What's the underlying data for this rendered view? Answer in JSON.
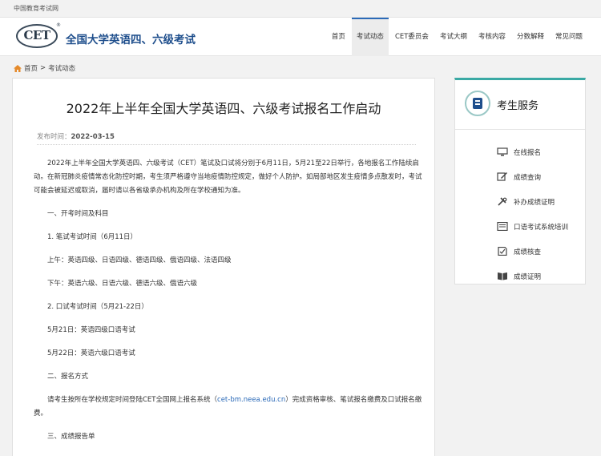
{
  "topbar": {
    "site_name": "中国教育考试网"
  },
  "header": {
    "logo_text": "CET",
    "logo_mark": "®",
    "title": "全国大学英语四、六级考试"
  },
  "nav": {
    "items": [
      {
        "label": "首页"
      },
      {
        "label": "考试动态"
      },
      {
        "label": "CET委员会"
      },
      {
        "label": "考试大纲"
      },
      {
        "label": "考核内容"
      },
      {
        "label": "分数解释"
      },
      {
        "label": "常见问题"
      }
    ]
  },
  "breadcrumb": {
    "home": "首页",
    "separator": ">",
    "current": "考试动态"
  },
  "article": {
    "title": "2022年上半年全国大学英语四、六级考试报名工作启动",
    "date_label": "发布时间：",
    "date": "2022-03-15",
    "intro": "2022年上半年全国大学英语四、六级考试（CET）笔试及口试将分别于6月11日，5月21至22日举行，各地报名工作陆续启动。在新冠肺炎疫情常态化防控时期，考生须严格遵守当地疫情防控规定，做好个人防护。如局部地区发生疫情多点散发时，考试可能会被延迟或取消，届时请以各省级承办机构及所在学校通知为准。",
    "s1": "一、开考时间及科目",
    "s1_1": "1. 笔试考试时间（6月11日）",
    "am": "上午：英语四级、日语四级、德语四级、俄语四级、法语四级",
    "pm": "下午：英语六级、日语六级、德语六级、俄语六级",
    "s1_2": "2. 口试考试时间（5月21-22日）",
    "oral1": "5月21日：英语四级口语考试",
    "oral2": "5月22日：英语六级口语考试",
    "s2": "二、报名方式",
    "reg_pre": "请考生按所在学校规定时间登陆CET全国网上报名系统（",
    "reg_link": "cet-bm.neea.edu.cn",
    "reg_post": "）完成资格审核、笔试报名缴费及口试报名缴费。",
    "s3": "三、成绩报告单"
  },
  "side": {
    "title": "考生服务",
    "items": [
      {
        "label": "在线报名",
        "icon": "monitor-icon"
      },
      {
        "label": "成绩查询",
        "icon": "edit-icon"
      },
      {
        "label": "补办成绩证明",
        "icon": "tools-icon"
      },
      {
        "label": "口语考试系统培训",
        "icon": "screen-icon"
      },
      {
        "label": "成绩核查",
        "icon": "check-doc-icon"
      },
      {
        "label": "成绩证明",
        "icon": "book-icon"
      }
    ]
  },
  "colors": {
    "accent": "#1e4e8c",
    "teal": "#3aa9a4",
    "link": "#2b6ab8"
  }
}
